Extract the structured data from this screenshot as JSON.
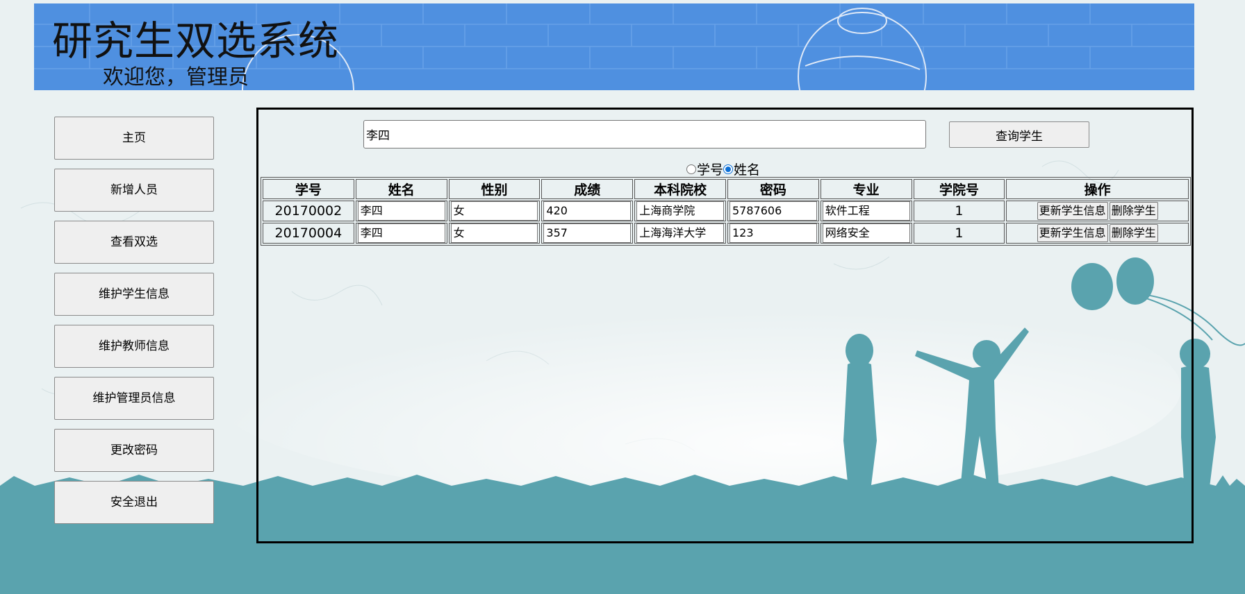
{
  "header": {
    "title": "研究生双选系统",
    "welcome": "欢迎您，管理员"
  },
  "sidebar": {
    "items": [
      {
        "label": "主页"
      },
      {
        "label": "新增人员"
      },
      {
        "label": "查看双选"
      },
      {
        "label": "维护学生信息"
      },
      {
        "label": "维护教师信息"
      },
      {
        "label": "维护管理员信息"
      },
      {
        "label": "更改密码"
      },
      {
        "label": "安全退出"
      }
    ]
  },
  "search": {
    "value": "李四",
    "button_label": "查询学生",
    "options": [
      {
        "label": "学号",
        "checked": false
      },
      {
        "label": "姓名",
        "checked": true
      }
    ]
  },
  "table": {
    "headers": [
      "学号",
      "姓名",
      "性别",
      "成绩",
      "本科院校",
      "密码",
      "专业",
      "学院号",
      "操作"
    ],
    "rows": [
      {
        "id": "20170002",
        "name": "李四",
        "gender": "女",
        "score": "420",
        "school": "上海商学院",
        "password": "5787606",
        "major": "软件工程",
        "college": "1",
        "update": "更新学生信息",
        "delete": "删除学生"
      },
      {
        "id": "20170004",
        "name": "李四",
        "gender": "女",
        "score": "357",
        "school": "上海海洋大学",
        "password": "123",
        "major": "网络安全",
        "college": "1",
        "update": "更新学生信息",
        "delete": "删除学生"
      }
    ]
  },
  "colors": {
    "banner": "#4f90e0",
    "grass": "#5aa3ae",
    "radio_checked": "#0b6fd6"
  }
}
